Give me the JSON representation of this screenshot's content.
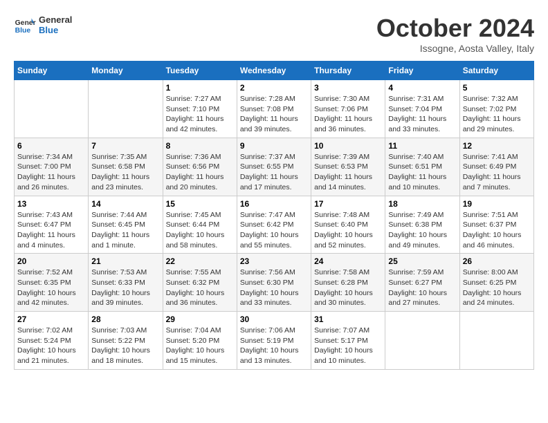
{
  "header": {
    "logo_general": "General",
    "logo_blue": "Blue",
    "month_title": "October 2024",
    "subtitle": "Issogne, Aosta Valley, Italy"
  },
  "days_of_week": [
    "Sunday",
    "Monday",
    "Tuesday",
    "Wednesday",
    "Thursday",
    "Friday",
    "Saturday"
  ],
  "weeks": [
    [
      {
        "day": "",
        "info": ""
      },
      {
        "day": "",
        "info": ""
      },
      {
        "day": "1",
        "sunrise": "7:27 AM",
        "sunset": "7:10 PM",
        "daylight": "11 hours and 42 minutes."
      },
      {
        "day": "2",
        "sunrise": "7:28 AM",
        "sunset": "7:08 PM",
        "daylight": "11 hours and 39 minutes."
      },
      {
        "day": "3",
        "sunrise": "7:30 AM",
        "sunset": "7:06 PM",
        "daylight": "11 hours and 36 minutes."
      },
      {
        "day": "4",
        "sunrise": "7:31 AM",
        "sunset": "7:04 PM",
        "daylight": "11 hours and 33 minutes."
      },
      {
        "day": "5",
        "sunrise": "7:32 AM",
        "sunset": "7:02 PM",
        "daylight": "11 hours and 29 minutes."
      }
    ],
    [
      {
        "day": "6",
        "sunrise": "7:34 AM",
        "sunset": "7:00 PM",
        "daylight": "11 hours and 26 minutes."
      },
      {
        "day": "7",
        "sunrise": "7:35 AM",
        "sunset": "6:58 PM",
        "daylight": "11 hours and 23 minutes."
      },
      {
        "day": "8",
        "sunrise": "7:36 AM",
        "sunset": "6:56 PM",
        "daylight": "11 hours and 20 minutes."
      },
      {
        "day": "9",
        "sunrise": "7:37 AM",
        "sunset": "6:55 PM",
        "daylight": "11 hours and 17 minutes."
      },
      {
        "day": "10",
        "sunrise": "7:39 AM",
        "sunset": "6:53 PM",
        "daylight": "11 hours and 14 minutes."
      },
      {
        "day": "11",
        "sunrise": "7:40 AM",
        "sunset": "6:51 PM",
        "daylight": "11 hours and 10 minutes."
      },
      {
        "day": "12",
        "sunrise": "7:41 AM",
        "sunset": "6:49 PM",
        "daylight": "11 hours and 7 minutes."
      }
    ],
    [
      {
        "day": "13",
        "sunrise": "7:43 AM",
        "sunset": "6:47 PM",
        "daylight": "11 hours and 4 minutes."
      },
      {
        "day": "14",
        "sunrise": "7:44 AM",
        "sunset": "6:45 PM",
        "daylight": "11 hours and 1 minute."
      },
      {
        "day": "15",
        "sunrise": "7:45 AM",
        "sunset": "6:44 PM",
        "daylight": "10 hours and 58 minutes."
      },
      {
        "day": "16",
        "sunrise": "7:47 AM",
        "sunset": "6:42 PM",
        "daylight": "10 hours and 55 minutes."
      },
      {
        "day": "17",
        "sunrise": "7:48 AM",
        "sunset": "6:40 PM",
        "daylight": "10 hours and 52 minutes."
      },
      {
        "day": "18",
        "sunrise": "7:49 AM",
        "sunset": "6:38 PM",
        "daylight": "10 hours and 49 minutes."
      },
      {
        "day": "19",
        "sunrise": "7:51 AM",
        "sunset": "6:37 PM",
        "daylight": "10 hours and 46 minutes."
      }
    ],
    [
      {
        "day": "20",
        "sunrise": "7:52 AM",
        "sunset": "6:35 PM",
        "daylight": "10 hours and 42 minutes."
      },
      {
        "day": "21",
        "sunrise": "7:53 AM",
        "sunset": "6:33 PM",
        "daylight": "10 hours and 39 minutes."
      },
      {
        "day": "22",
        "sunrise": "7:55 AM",
        "sunset": "6:32 PM",
        "daylight": "10 hours and 36 minutes."
      },
      {
        "day": "23",
        "sunrise": "7:56 AM",
        "sunset": "6:30 PM",
        "daylight": "10 hours and 33 minutes."
      },
      {
        "day": "24",
        "sunrise": "7:58 AM",
        "sunset": "6:28 PM",
        "daylight": "10 hours and 30 minutes."
      },
      {
        "day": "25",
        "sunrise": "7:59 AM",
        "sunset": "6:27 PM",
        "daylight": "10 hours and 27 minutes."
      },
      {
        "day": "26",
        "sunrise": "8:00 AM",
        "sunset": "6:25 PM",
        "daylight": "10 hours and 24 minutes."
      }
    ],
    [
      {
        "day": "27",
        "sunrise": "7:02 AM",
        "sunset": "5:24 PM",
        "daylight": "10 hours and 21 minutes."
      },
      {
        "day": "28",
        "sunrise": "7:03 AM",
        "sunset": "5:22 PM",
        "daylight": "10 hours and 18 minutes."
      },
      {
        "day": "29",
        "sunrise": "7:04 AM",
        "sunset": "5:20 PM",
        "daylight": "10 hours and 15 minutes."
      },
      {
        "day": "30",
        "sunrise": "7:06 AM",
        "sunset": "5:19 PM",
        "daylight": "10 hours and 13 minutes."
      },
      {
        "day": "31",
        "sunrise": "7:07 AM",
        "sunset": "5:17 PM",
        "daylight": "10 hours and 10 minutes."
      },
      {
        "day": "",
        "info": ""
      },
      {
        "day": "",
        "info": ""
      }
    ]
  ]
}
